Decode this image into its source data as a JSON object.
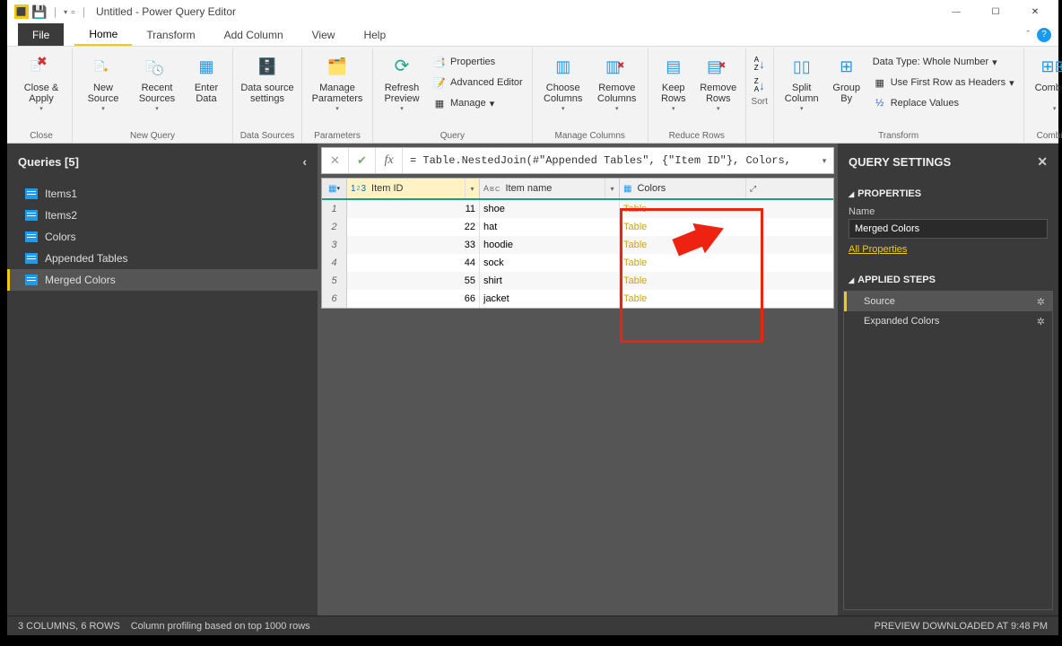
{
  "title": "Untitled - Power Query Editor",
  "ribbon_tabs": {
    "file": "File",
    "home": "Home",
    "transform": "Transform",
    "addcol": "Add Column",
    "view": "View",
    "help": "Help"
  },
  "ribbon": {
    "close": {
      "btn": "Close &\nApply",
      "label": "Close"
    },
    "newquery": {
      "new": "New\nSource",
      "recent": "Recent\nSources",
      "enter": "Enter\nData",
      "label": "New Query"
    },
    "datasources": {
      "settings": "Data source\nsettings",
      "label": "Data Sources"
    },
    "parameters": {
      "manage": "Manage\nParameters",
      "label": "Parameters"
    },
    "query": {
      "refresh": "Refresh\nPreview",
      "properties": "Properties",
      "advanced": "Advanced Editor",
      "manage": "Manage",
      "label": "Query"
    },
    "managecols": {
      "choose": "Choose\nColumns",
      "remove": "Remove\nColumns",
      "label": "Manage Columns"
    },
    "reducerows": {
      "keep": "Keep\nRows",
      "remove": "Remove\nRows",
      "label": "Reduce Rows"
    },
    "sort": {
      "label": "Sort"
    },
    "transform": {
      "split": "Split\nColumn",
      "group": "Group\nBy",
      "datatype": "Data Type: Whole Number",
      "firstrow": "Use First Row as Headers",
      "replace": "Replace Values",
      "label": "Transform"
    },
    "combine": {
      "btn": "Combine",
      "label": "Combine"
    }
  },
  "queries_panel": {
    "title": "Queries [5]",
    "items": [
      "Items1",
      "Items2",
      "Colors",
      "Appended Tables",
      "Merged Colors"
    ],
    "selected": 4
  },
  "formula": "= Table.NestedJoin(#\"Appended Tables\", {\"Item ID\"}, Colors,",
  "grid": {
    "columns": [
      {
        "name": "Item ID",
        "type": "1²3"
      },
      {
        "name": "Item name",
        "type": "ABC"
      },
      {
        "name": "Colors",
        "type": "table"
      }
    ],
    "rows": [
      {
        "n": 1,
        "id": 11,
        "name": "shoe",
        "colors": "Table"
      },
      {
        "n": 2,
        "id": 22,
        "name": "hat",
        "colors": "Table"
      },
      {
        "n": 3,
        "id": 33,
        "name": "hoodie",
        "colors": "Table"
      },
      {
        "n": 4,
        "id": 44,
        "name": "sock",
        "colors": "Table"
      },
      {
        "n": 5,
        "id": 55,
        "name": "shirt",
        "colors": "Table"
      },
      {
        "n": 6,
        "id": 66,
        "name": "jacket",
        "colors": "Table"
      }
    ]
  },
  "query_settings": {
    "title": "QUERY SETTINGS",
    "properties_title": "PROPERTIES",
    "name_label": "Name",
    "name_value": "Merged Colors",
    "all_props": "All Properties",
    "steps_title": "APPLIED STEPS",
    "steps": [
      "Source",
      "Expanded Colors"
    ],
    "selected_step": 0
  },
  "status": {
    "left": "3 COLUMNS, 6 ROWS",
    "mid": "Column profiling based on top 1000 rows",
    "right": "PREVIEW DOWNLOADED AT 9:48 PM"
  }
}
